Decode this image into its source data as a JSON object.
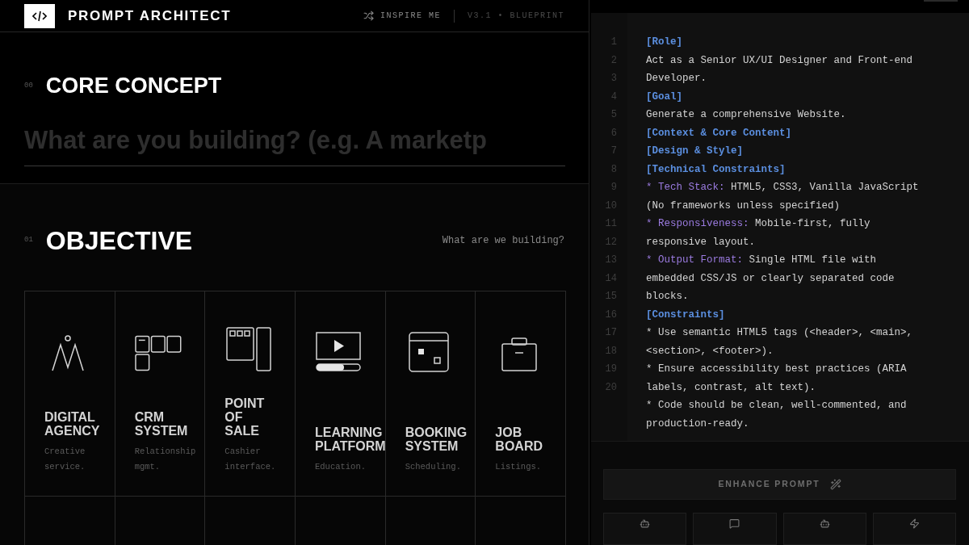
{
  "header": {
    "title": "PROMPT ARCHITECT",
    "inspire": "INSPIRE ME",
    "version": "V3.1 • BLUEPRINT"
  },
  "core": {
    "number": "00",
    "title": "CORE CONCEPT",
    "placeholder": "What are you building? (e.g. A marketp"
  },
  "objective": {
    "number": "01",
    "title": "OBJECTIVE",
    "hint": "What are we building?",
    "tiles": [
      {
        "kind": "agency",
        "title": "DIGITAL AGENCY",
        "desc": "Creative service."
      },
      {
        "kind": "crm",
        "title": "CRM SYSTEM",
        "desc": "Relationship mgmt."
      },
      {
        "kind": "pos",
        "title": "POINT OF SALE",
        "desc": "Cashier interface."
      },
      {
        "kind": "learning",
        "title": "LEARNING PLATFORM",
        "desc": "Education."
      },
      {
        "kind": "booking",
        "title": "BOOKING SYSTEM",
        "desc": "Scheduling."
      },
      {
        "kind": "job",
        "title": "JOB BOARD",
        "desc": "Listings."
      }
    ]
  },
  "editor": {
    "line_numbers": [
      "1",
      "2",
      "3",
      "4",
      "5",
      "6",
      "7",
      "8",
      "9",
      "10",
      "11",
      "12",
      "13",
      "14",
      "15",
      "16",
      "17",
      "18",
      "19",
      "20"
    ],
    "lines": [
      [
        {
          "kind": "section",
          "text": "[Role]"
        }
      ],
      [
        {
          "kind": "text",
          "text": "Act as a Senior UX/UI Designer and Front-end"
        }
      ],
      [
        {
          "kind": "text",
          "text": "Developer."
        }
      ],
      [
        {
          "kind": "section",
          "text": "[Goal]"
        }
      ],
      [
        {
          "kind": "text",
          "text": "Generate a comprehensive Website."
        }
      ],
      [
        {
          "kind": "section",
          "text": "[Context & Core Content]"
        }
      ],
      [
        {
          "kind": "section",
          "text": "[Design & Style]"
        }
      ],
      [
        {
          "kind": "section",
          "text": "[Technical Constraints]"
        }
      ],
      [
        {
          "kind": "key",
          "text": "* Tech Stack:"
        },
        {
          "kind": "text",
          "text": " HTML5, CSS3, Vanilla JavaScript"
        }
      ],
      [
        {
          "kind": "text",
          "text": "(No frameworks unless specified)"
        }
      ],
      [
        {
          "kind": "key",
          "text": "* Responsiveness:"
        },
        {
          "kind": "text",
          "text": " Mobile-first, fully"
        }
      ],
      [
        {
          "kind": "text",
          "text": "responsive layout."
        }
      ],
      [
        {
          "kind": "key",
          "text": "* Output Format:"
        },
        {
          "kind": "text",
          "text": " Single HTML file with"
        }
      ],
      [
        {
          "kind": "text",
          "text": "embedded CSS/JS or clearly separated code"
        }
      ],
      [
        {
          "kind": "text",
          "text": "blocks."
        }
      ],
      [
        {
          "kind": "section",
          "text": "[Constraints]"
        }
      ],
      [
        {
          "kind": "text",
          "text": "* Use semantic HTML5 tags (<header>, <main>,"
        }
      ],
      [
        {
          "kind": "text",
          "text": "<section>, <footer>)."
        }
      ],
      [
        {
          "kind": "text",
          "text": "* Ensure accessibility best practices (ARIA"
        }
      ],
      [
        {
          "kind": "text",
          "text": "labels, contrast, alt text)."
        }
      ],
      [
        {
          "kind": "text",
          "text": "* Code should be clean, well-commented, and"
        }
      ],
      [
        {
          "kind": "text",
          "text": "production-ready."
        }
      ]
    ]
  },
  "enhance": "ENHANCE PROMPT",
  "actions": [
    {
      "kind": "robot"
    },
    {
      "kind": "chat"
    },
    {
      "kind": "robot"
    },
    {
      "kind": "bolt"
    }
  ]
}
